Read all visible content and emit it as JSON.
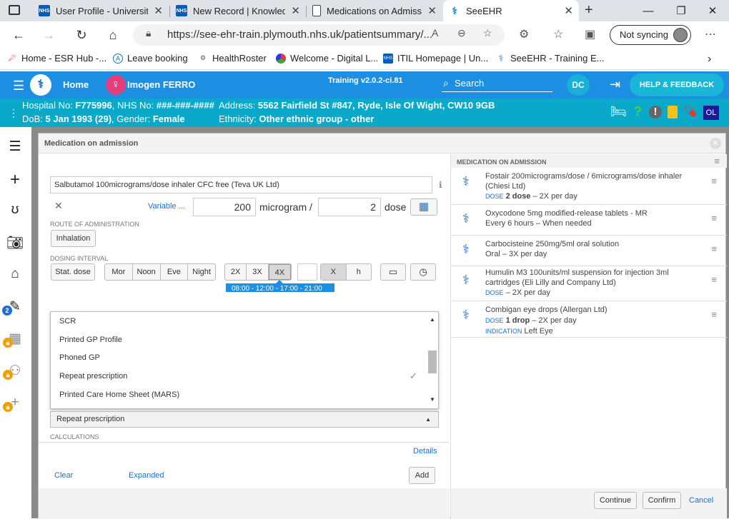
{
  "browser": {
    "tabs": [
      {
        "title": "User Profile - University",
        "icon": "NHS"
      },
      {
        "title": "New Record | Knowledg",
        "icon": "NHS"
      },
      {
        "title": "Medications on Admiss",
        "icon": "doc"
      },
      {
        "title": "SeeEHR",
        "icon": "seeehr"
      }
    ],
    "url": "https://see-ehr-train.plymouth.nhs.uk/patientsummary/...",
    "not_syncing": "Not syncing",
    "bookmarks": [
      "Home - ESR Hub -...",
      "Leave booking",
      "HealthRoster",
      "Welcome - Digital L...",
      "ITIL Homepage | Un...",
      "SeeEHR - Training E..."
    ]
  },
  "app": {
    "home": "Home",
    "patient_name": "Imogen FERRO",
    "version": "Training v2.0.2-ci.81",
    "search": "Search",
    "user_initials": "DC",
    "help": "HELP & FEEDBACK"
  },
  "banner": {
    "hospital_label": "Hospital No: ",
    "hospital_no": "F775996",
    "nhs_label": ", NHS No: ",
    "nhs_no": "###-###-####",
    "address_label": "Address: ",
    "address": "5562 Fairfield St #847, Ryde, Isle Of Wight, CW10 9GB",
    "dob_label": "DoB: ",
    "dob": "5 Jan 1993 (29)",
    "gender_label": ", Gender: ",
    "gender": "Female",
    "ethnicity_label": "Ethnicity: ",
    "ethnicity": "Other ethnic group - other",
    "ol": "OL"
  },
  "rail": {
    "badge_count": "2"
  },
  "dialog": {
    "title": "Medication on admission",
    "medication": "Salbutamol 100micrograms/dose inhaler CFC free (Teva UK Ltd)",
    "variable_link": "Variable ...",
    "dose_value": "200",
    "dose_unit": "microgram /",
    "per_value": "2",
    "per_unit": "dose",
    "route_label": "ROUTE OF ADMINISTRATION",
    "route": "Inhalation",
    "dosing_label": "DOSING INTERVAL",
    "stat_dose": "Stat. dose",
    "times": [
      "Mor",
      "Noon",
      "Eve",
      "Night"
    ],
    "freq": [
      "2X",
      "3X",
      "4X"
    ],
    "selected_freq": "4X",
    "x_label": "X",
    "h_label": "h",
    "time_strip": "08:00 - 12:00 - 17:00 - 21:00",
    "source_options": [
      "SCR",
      "Printed GP Profile",
      "Phoned GP",
      "Repeat prescription",
      "Printed Care Home Sheet (MARS)"
    ],
    "source_selected": "Repeat prescription",
    "calculations_label": "CALCULATIONS",
    "details_link": "Details",
    "clear": "Clear",
    "expanded": "Expanded",
    "add": "Add",
    "continue": "Continue",
    "confirm": "Confirm",
    "cancel": "Cancel"
  },
  "med_list": {
    "header": "MEDICATION ON ADMISSION",
    "items": [
      {
        "name": "Fostair 200micrograms/dose / 6micrograms/dose inhaler (Chiesi Ltd)",
        "cap1": "DOSE",
        "bold": "2 dose",
        "rest": " – 2X per day",
        "cap2": "",
        "extra": ""
      },
      {
        "name": "Oxycodone 5mg modified-release tablets - MR",
        "cap1": "",
        "bold": "",
        "rest": "Every 6 hours – When needed",
        "cap2": "",
        "extra": ""
      },
      {
        "name": "Carbocisteine 250mg/5ml oral solution",
        "cap1": "",
        "bold": "",
        "rest": "Oral – 3X per day",
        "cap2": "",
        "extra": ""
      },
      {
        "name": "Humulin M3 100units/ml suspension for injection 3ml cartridges (Eli Lilly and Company Ltd)",
        "cap1": "DOSE",
        "bold": "",
        "rest": " – 2X per day",
        "cap2": "",
        "extra": ""
      },
      {
        "name": "Combigan eye drops (Allergan Ltd)",
        "cap1": "DOSE",
        "bold": "1 drop",
        "rest": " – 2X per day",
        "cap2": "INDICATION",
        "extra": " Left Eye"
      }
    ]
  }
}
